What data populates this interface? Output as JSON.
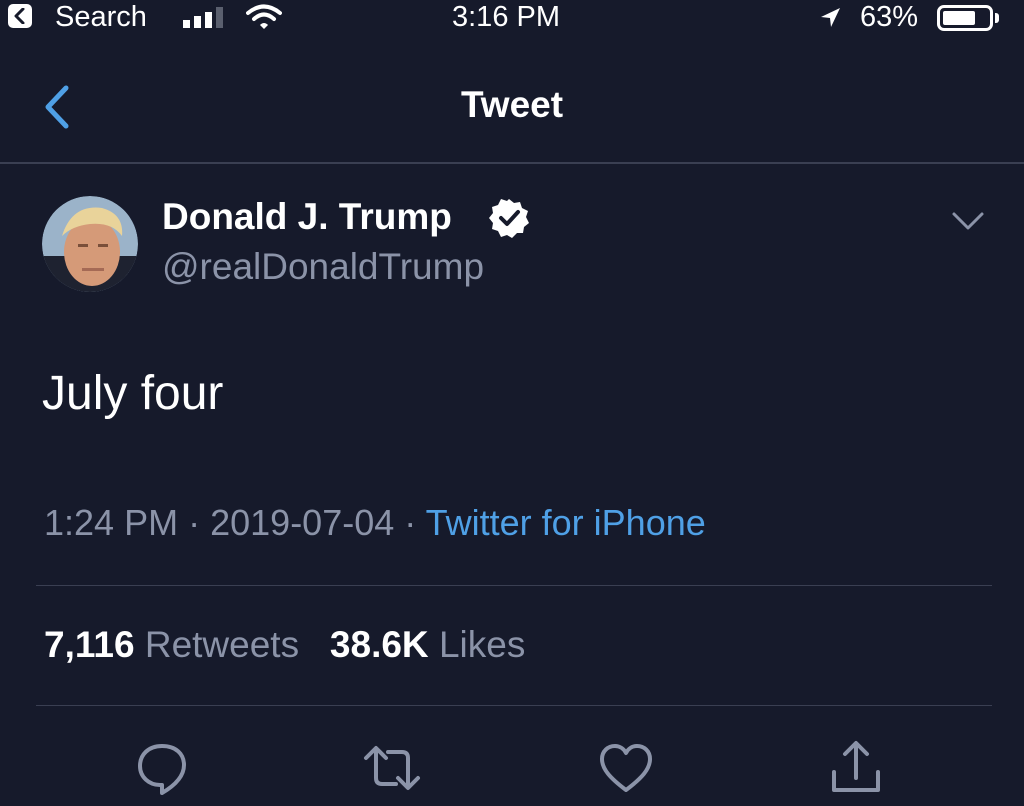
{
  "status_bar": {
    "back_app_label": "Search",
    "time": "3:16 PM",
    "battery_percent": "63%",
    "battery_level": 0.63
  },
  "nav": {
    "title": "Tweet"
  },
  "tweet": {
    "author_name": "Donald J. Trump",
    "author_handle": "@realDonaldTrump",
    "verified": true,
    "text": "July four",
    "time": "1:24 PM",
    "separator": "·",
    "date": "2019-07-04",
    "source": "Twitter for iPhone"
  },
  "stats": {
    "retweets_count": "7,116",
    "retweets_label": "Retweets",
    "likes_count": "38.6K",
    "likes_label": "Likes"
  },
  "actions": [
    {
      "icon": "reply-icon"
    },
    {
      "icon": "retweet-icon"
    },
    {
      "icon": "like-icon"
    },
    {
      "icon": "share-icon"
    }
  ],
  "colors": {
    "background": "#161a2b",
    "link_blue": "#4fa0e6",
    "secondary_text": "#8b93a8"
  }
}
